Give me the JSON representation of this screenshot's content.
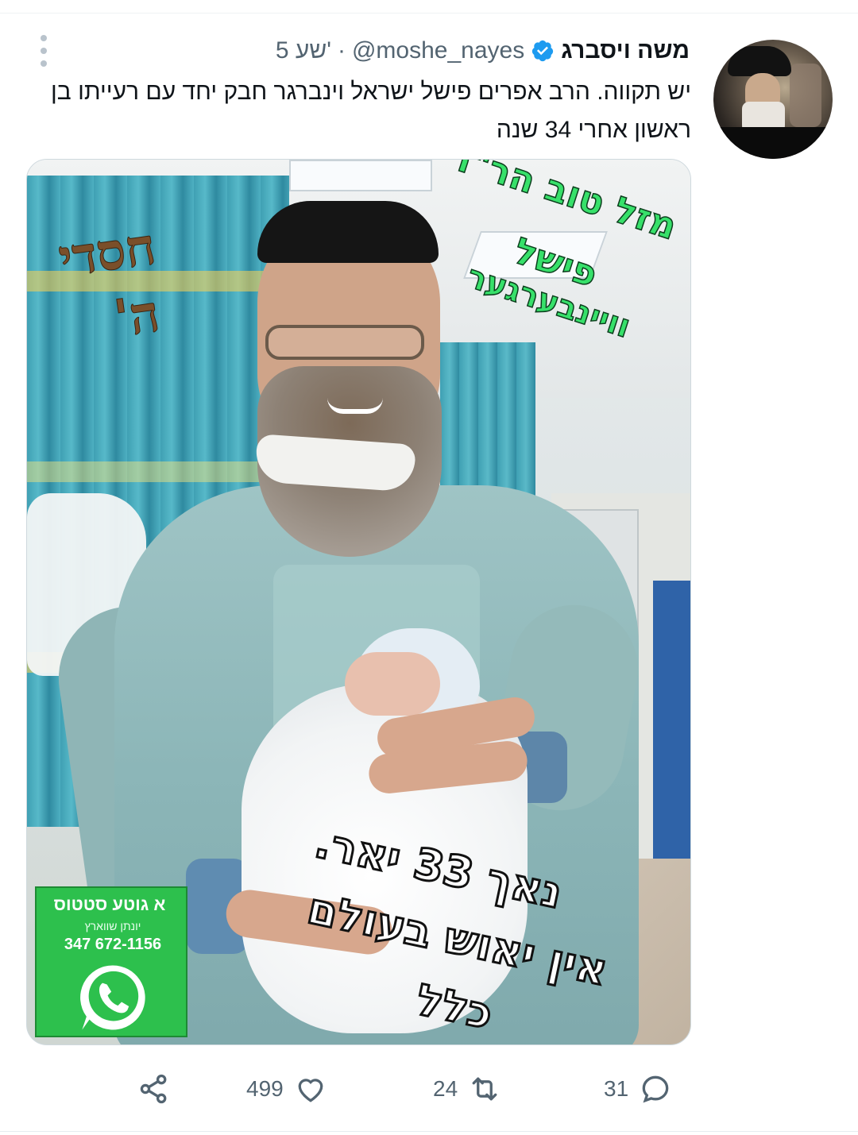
{
  "tweet": {
    "display_name": "משה ויסברג",
    "handle": "@moshe_nayes",
    "separator": "·",
    "time": "5 שע'",
    "text": "יש תקווה. הרב אפרים פישל ישראל וינברגר חבק יחד עם רעייתו בן ראשון אחרי 34 שנה"
  },
  "media": {
    "overlay_green_lines": [
      "מזל טוב הר\"ר",
      "פישל",
      "וויינבערגער"
    ],
    "overlay_brown_lines": [
      "חסדי",
      "ה'"
    ],
    "overlay_white_lines": [
      "נאך 33 יאר.",
      "אין יאוש בעולם",
      "כלל"
    ],
    "promo": {
      "title": "א גוטע סטטוס",
      "name": "יונתן שווארץ",
      "phone": "347 672-1156"
    }
  },
  "actions": {
    "replies": "31",
    "retweets": "24",
    "likes": "499"
  },
  "colors": {
    "text_primary": "#0f1419",
    "text_secondary": "#536471",
    "verified": "#1d9bf0",
    "overlay_green": "#37e06a",
    "whatsapp_green": "#2dc04d"
  },
  "icons": [
    "more-icon",
    "verified-icon",
    "reply-icon",
    "retweet-icon",
    "like-icon",
    "share-icon",
    "whatsapp-icon"
  ]
}
